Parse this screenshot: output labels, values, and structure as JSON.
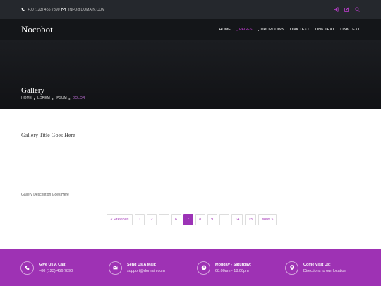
{
  "topbar": {
    "phone": "+00 (123) 456 7890",
    "email": "INFO@DOMAIN.COM",
    "tools": [
      {
        "icon": "sign-in-icon"
      },
      {
        "icon": "edit-icon"
      },
      {
        "icon": "search-icon"
      }
    ]
  },
  "nav": {
    "brand": "Nocobot",
    "items": [
      {
        "label": "HOME",
        "caret": false,
        "active": false
      },
      {
        "label": "PAGES",
        "caret": true,
        "active": true
      },
      {
        "label": "DROPDOWN",
        "caret": true,
        "active": false
      },
      {
        "label": "LINK TEXT",
        "caret": false,
        "active": false
      },
      {
        "label": "LINK TEXT",
        "caret": false,
        "active": false
      },
      {
        "label": "LINK TEXT",
        "caret": false,
        "active": false
      }
    ]
  },
  "hero": {
    "title": "Gallery",
    "breadcrumb": [
      "HOME",
      "LOREM",
      "IPSUM",
      "DOLOR"
    ]
  },
  "main": {
    "title": "Gallery Title Goes Here",
    "description": "Gallery Description Goes Here"
  },
  "pagination": {
    "prev": "« Previous",
    "pages": [
      "1",
      "2",
      "...",
      "6",
      "7",
      "8",
      "9",
      "...",
      "14",
      "15"
    ],
    "current": "7",
    "next": "Next »"
  },
  "footer": [
    {
      "icon": "phone-icon",
      "heading": "Give Us A Call:",
      "value": "+00 (123) 456 7890"
    },
    {
      "icon": "mail-icon",
      "heading": "Send Us A Mail:",
      "value": "support@domain.com"
    },
    {
      "icon": "clock-icon",
      "heading": "Monday - Saturday:",
      "value": "08.00am - 18.00pm"
    },
    {
      "icon": "map-marker-icon",
      "heading": "Come Visit Us:",
      "value": "Directions to our location"
    }
  ],
  "colors": {
    "accent": "#9c33b6",
    "topbar": "#25282d",
    "navbar": "#141619",
    "footer": "#9e32b4"
  }
}
